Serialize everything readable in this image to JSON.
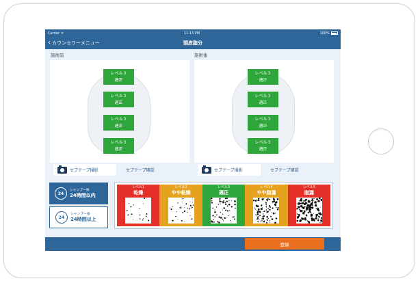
{
  "status_bar": {
    "carrier": "Carrier ᯤ",
    "time": "11:13 PM",
    "battery": "100%"
  },
  "nav": {
    "back_label": "カウンセラーメニュー",
    "title": "頭皮脂分"
  },
  "panels": [
    {
      "label": "施術前",
      "badges": [
        {
          "level": "レベル３",
          "status": "適正"
        },
        {
          "level": "レベル３",
          "status": "適正"
        },
        {
          "level": "レベル３",
          "status": "適正"
        },
        {
          "level": "レベル３",
          "status": "適正"
        }
      ],
      "camera_label": "セブテープ撮影",
      "confirm_label": "セブテープ確認"
    },
    {
      "label": "施術後",
      "badges": [
        {
          "level": "レベル３",
          "status": "適正"
        },
        {
          "level": "レベル３",
          "status": "適正"
        },
        {
          "level": "レベル３",
          "status": "適正"
        },
        {
          "level": "レベル３",
          "status": "適正"
        }
      ],
      "camera_label": "セブテープ撮影",
      "confirm_label": "セブテープ確認"
    }
  ],
  "shampoo_options": [
    {
      "icon_text": "24",
      "small": "シャンプー後",
      "big": "24時間以内",
      "active": true
    },
    {
      "icon_text": "24",
      "small": "シャンプー後",
      "big": "24時間以上",
      "active": false
    }
  ],
  "level_scale": [
    {
      "level": "レベル1",
      "name": "乾燥",
      "color": "#e5302a",
      "density": 0.08
    },
    {
      "level": "レベル2",
      "name": "やや乾燥",
      "color": "#e5a21f",
      "density": 0.15
    },
    {
      "level": "レベル3",
      "name": "適正",
      "color": "#2fa63c",
      "density": 0.28
    },
    {
      "level": "レベル4",
      "name": "やや脂漏",
      "color": "#e5a21f",
      "density": 0.45
    },
    {
      "level": "レベル5",
      "name": "脂漏",
      "color": "#e5302a",
      "density": 0.62
    }
  ],
  "register_label": "登録",
  "colors": {
    "nav": "#2e6699",
    "accent": "#e8701e",
    "ok_green": "#2fa63c"
  }
}
